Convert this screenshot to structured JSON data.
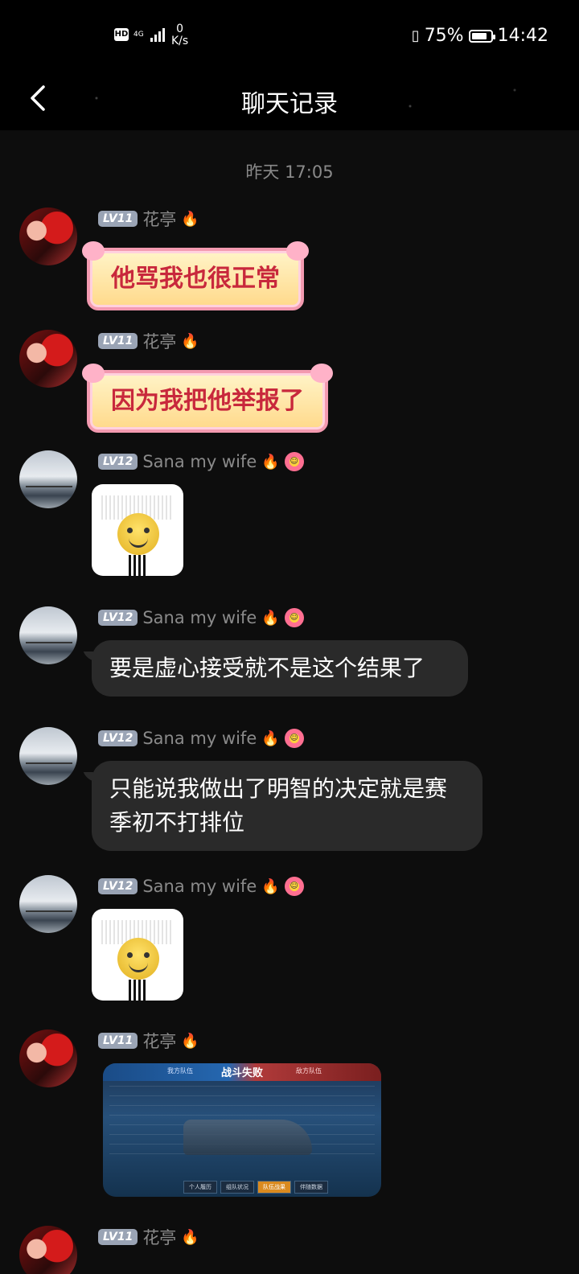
{
  "status": {
    "hd": "HD",
    "network": "4G",
    "speed_value": "0",
    "speed_unit": "K/s",
    "battery": "75%",
    "time": "14:42"
  },
  "header": {
    "title": "聊天记录"
  },
  "chat": {
    "timestamp": "昨天 17:05",
    "users": {
      "huating": {
        "level": "LV11",
        "name": "花亭"
      },
      "sana": {
        "level": "LV12",
        "name": "Sana my wife"
      }
    },
    "messages": [
      {
        "text": "他骂我也很正常"
      },
      {
        "text": "因为我把他举报了"
      },
      {
        "text": "要是虚心接受就不是这个结果了"
      },
      {
        "text": "只能说我做出了明智的决定就是赛季初不打排位"
      }
    ],
    "screenshot": {
      "title": "战斗失败",
      "left_team": "我方队伍",
      "right_team": "敌方队伍",
      "tabs": [
        "个人履历",
        "组队状况",
        "队伍战果",
        "伴随数据"
      ]
    }
  },
  "icons": {
    "back": "chevron-left-icon",
    "fire": "fire-icon",
    "flower": "flower-badge-icon"
  },
  "colors": {
    "background": "#0d0d0d",
    "bubble": "#2a2a2a",
    "level_badge": "#9aa4b5",
    "name_text": "#8a8a8a"
  }
}
